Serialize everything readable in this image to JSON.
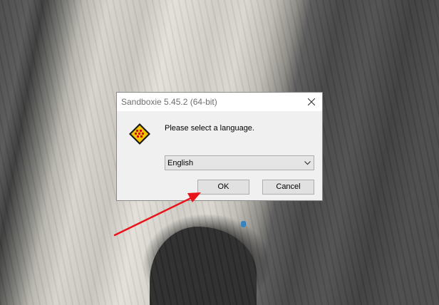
{
  "dialog": {
    "title": "Sandboxie 5.45.2 (64-bit)",
    "prompt": "Please select a language.",
    "language_select": {
      "selected": "English"
    },
    "ok_label": "OK",
    "cancel_label": "Cancel"
  },
  "icons": {
    "app": "sandboxie-logo-icon",
    "close": "close-icon",
    "dropdown": "chevron-down-icon"
  },
  "colors": {
    "annotation_arrow": "#e8141b",
    "logo_yellow": "#f5c400",
    "logo_red": "#d01010"
  }
}
